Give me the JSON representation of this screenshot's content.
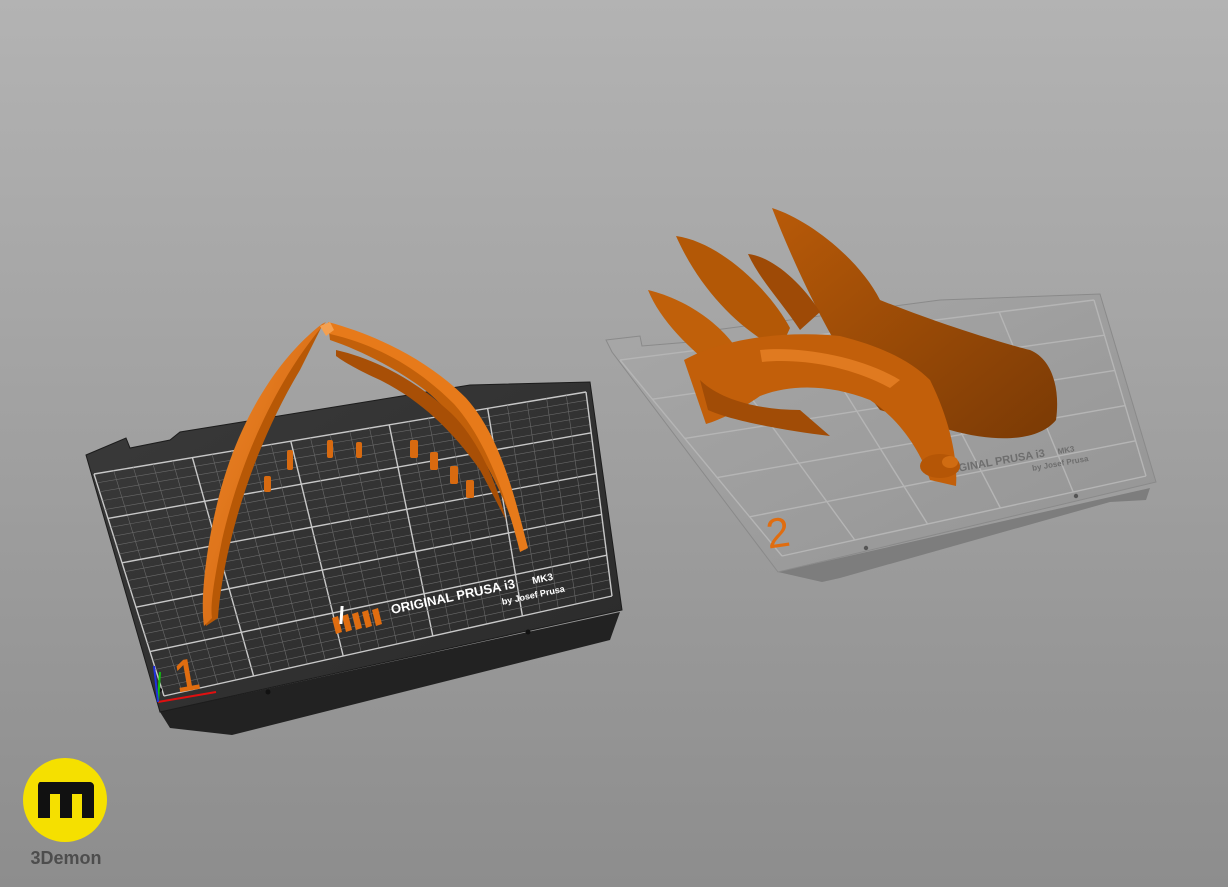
{
  "scene": {
    "background_top": "#b3b3b3",
    "background_bottom": "#8d8d8d",
    "model_color": "#e06d10",
    "model_shadow": "#7a3a05"
  },
  "plates": [
    {
      "number": "1",
      "state": "active",
      "brand_line": "ORIGINAL PRUSA i3",
      "model_tag": "MK3",
      "byline": "by Josef Prusa",
      "surface_color": "#2f2f2f"
    },
    {
      "number": "2",
      "state": "inactive",
      "brand_line": "ORIGINAL PRUSA i3",
      "model_tag": "MK3",
      "byline": "by Josef Prusa",
      "surface_color": "#9a9a9a"
    }
  ],
  "axes_gizmo": {
    "icon": "xyz-axes-icon",
    "colors": {
      "x": "#e01010",
      "y": "#10c010",
      "z": "#2030e0"
    }
  },
  "watermark": {
    "icon": "3demon-logo-icon",
    "text": "3Demon",
    "circle_color": "#f5e000"
  }
}
